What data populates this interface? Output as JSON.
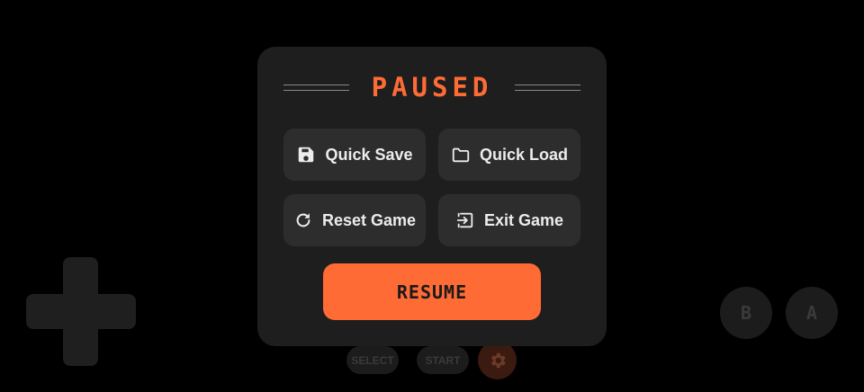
{
  "pause_menu": {
    "title": "PAUSED",
    "buttons": [
      {
        "label": "Quick Save",
        "icon": "floppy-disk-icon"
      },
      {
        "label": "Quick Load",
        "icon": "folder-icon"
      },
      {
        "label": "Reset Game",
        "icon": "refresh-icon"
      },
      {
        "label": "Exit Game",
        "icon": "exit-icon"
      }
    ],
    "resume_label": "RESUME"
  },
  "controls": {
    "b_label": "B",
    "a_label": "A",
    "select_label": "SELECT",
    "start_label": "START",
    "settings_icon": "gear-icon"
  },
  "colors": {
    "accent": "#ff6b35",
    "panel": "#1e1e1e",
    "button": "#2d2d2d",
    "background": "#000000"
  }
}
